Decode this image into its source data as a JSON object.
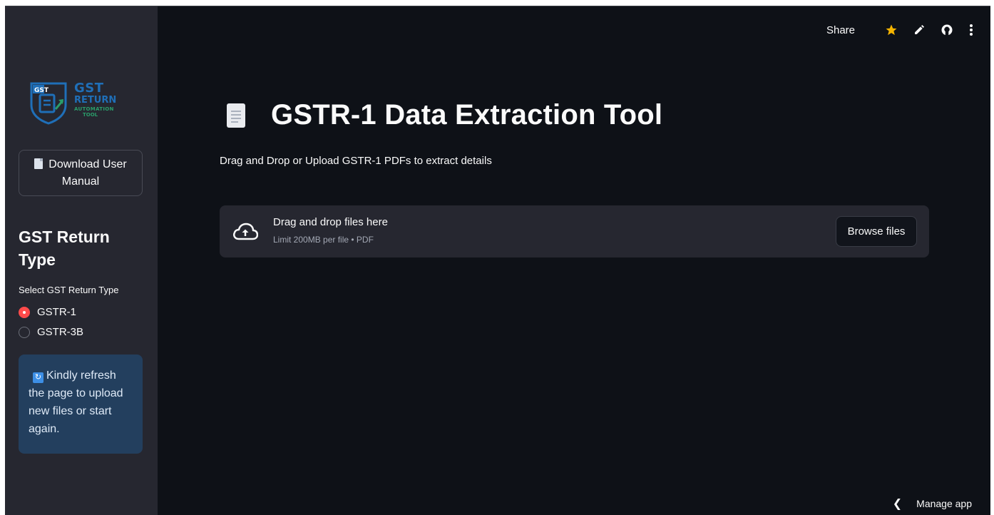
{
  "sidebar": {
    "logo": {
      "line1": "GST",
      "line2": "RETURN",
      "line3": "AUTOMATION",
      "line4": "TOOL",
      "badge": "GST"
    },
    "download_button": {
      "icon": "document-icon",
      "label": "Download User Manual"
    },
    "heading": "GST Return Type",
    "radio_label": "Select GST Return Type",
    "options": [
      {
        "label": "GSTR-1",
        "selected": true
      },
      {
        "label": "GSTR-3B",
        "selected": false
      }
    ],
    "info": {
      "icon": "refresh-icon",
      "lines": [
        "Kindly refresh",
        "the page to upload",
        "new files or start",
        "again."
      ]
    }
  },
  "toolbar": {
    "share_label": "Share",
    "icons": [
      "star-icon",
      "edit-icon",
      "github-icon",
      "more-vertical-icon"
    ]
  },
  "main": {
    "title": "GSTR-1 Data Extraction Tool",
    "title_icon": "page-icon",
    "subtitle": "Drag and Drop or Upload GSTR-1 PDFs to extract details",
    "uploader": {
      "icon": "cloud-upload-icon",
      "title": "Drag and drop files here",
      "limit": "Limit 200MB per file • PDF",
      "browse_label": "Browse files"
    }
  },
  "footer": {
    "manage_label": "Manage app"
  },
  "colors": {
    "background": "#0e1117",
    "sidebar": "#262730",
    "accent": "#ff4b4b",
    "star": "#f5b400",
    "info_bg": "#233f5e"
  }
}
